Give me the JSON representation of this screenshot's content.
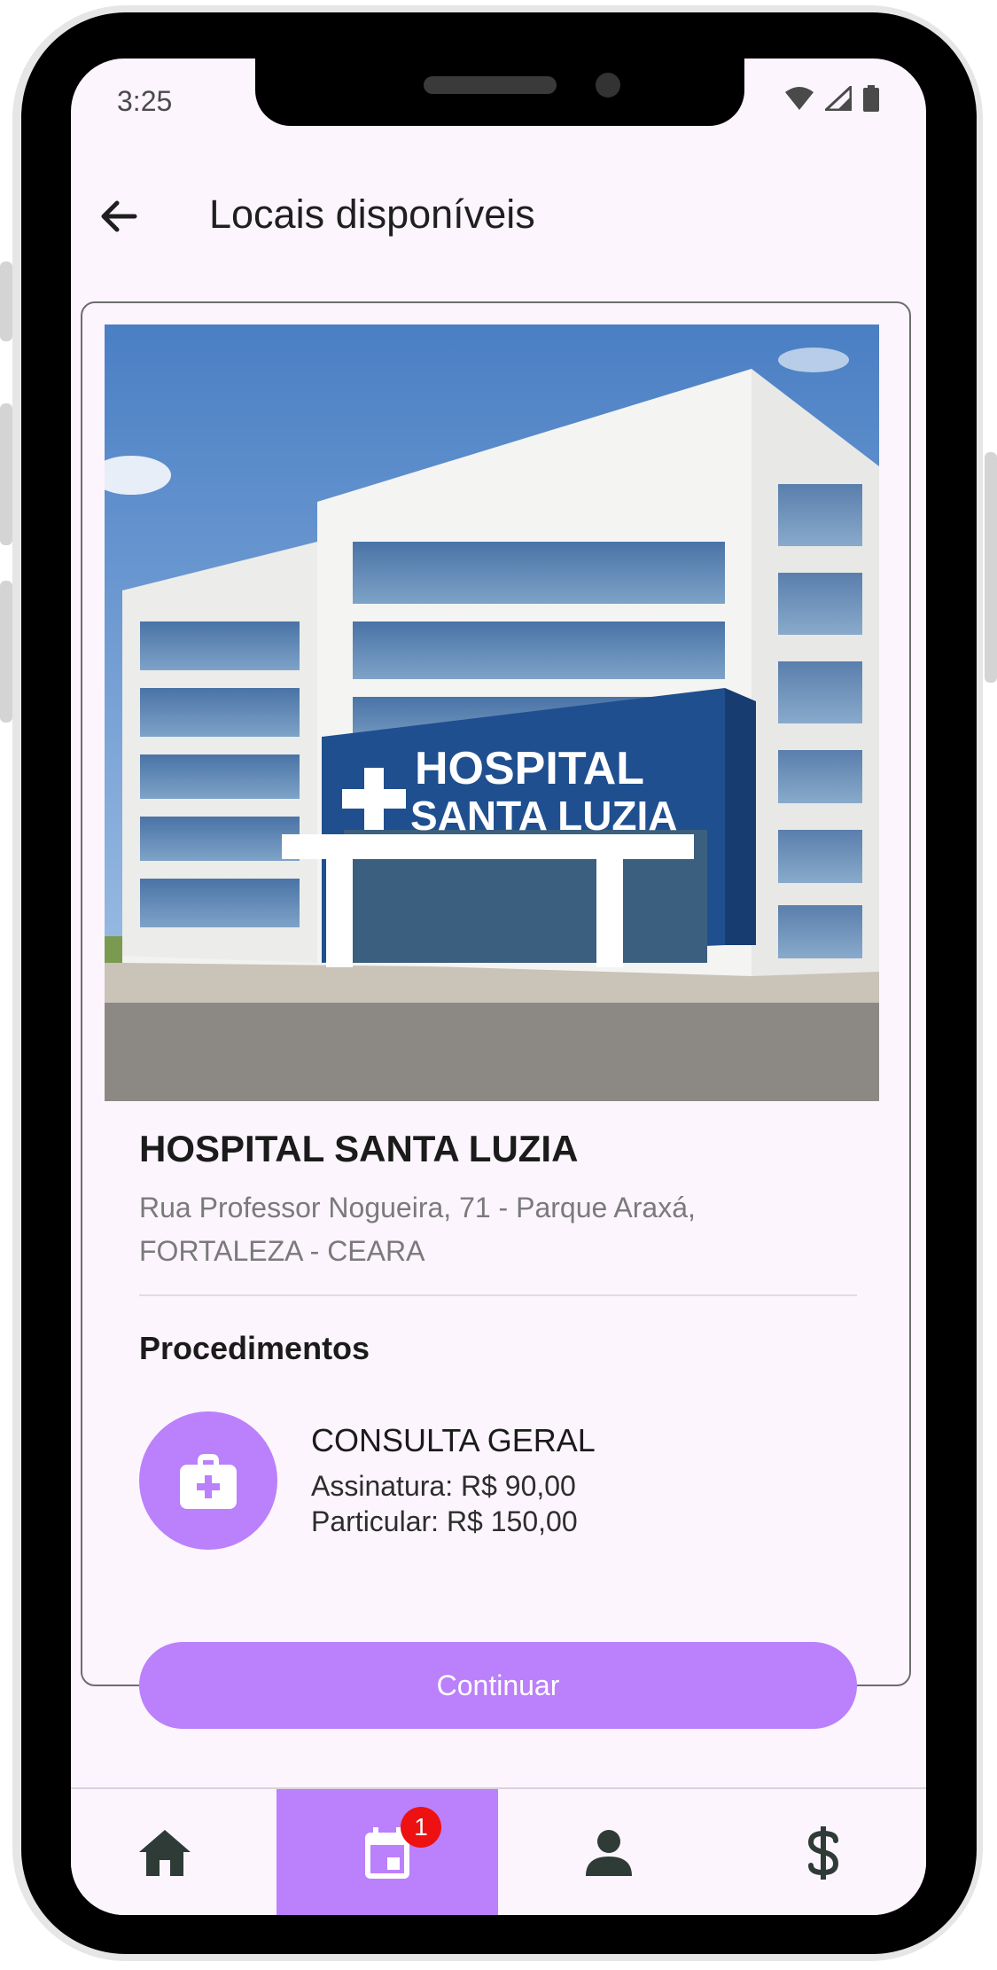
{
  "status_bar": {
    "time": "3:25"
  },
  "app_bar": {
    "title": "Locais disponíveis"
  },
  "hospital": {
    "sign_line1": "HOSPITAL",
    "sign_line2": "SANTA LUZIA",
    "name": "HOSPITAL SANTA LUZIA",
    "address_line1": "Rua Professor Nogueira, 71 - Parque Araxá,",
    "address_line2": "FORTALEZA - CEARA"
  },
  "procedures": {
    "title": "Procedimentos",
    "items": [
      {
        "name": "CONSULTA GERAL",
        "price_subscription": "Assinatura: R$ 90,00",
        "price_private": "Particular: R$ 150,00",
        "icon": "medical-bag-icon"
      }
    ]
  },
  "actions": {
    "continue_label": "Continuar"
  },
  "bottom_nav": {
    "items": [
      {
        "icon": "home-icon",
        "active": false
      },
      {
        "icon": "calendar-icon",
        "active": true,
        "badge": "1"
      },
      {
        "icon": "person-icon",
        "active": false
      },
      {
        "icon": "dollar-icon",
        "active": false
      }
    ]
  },
  "colors": {
    "accent": "#bb80fb",
    "background": "#fcf5fd",
    "badge": "#ee1111",
    "icon_dark": "#2e3b36"
  }
}
